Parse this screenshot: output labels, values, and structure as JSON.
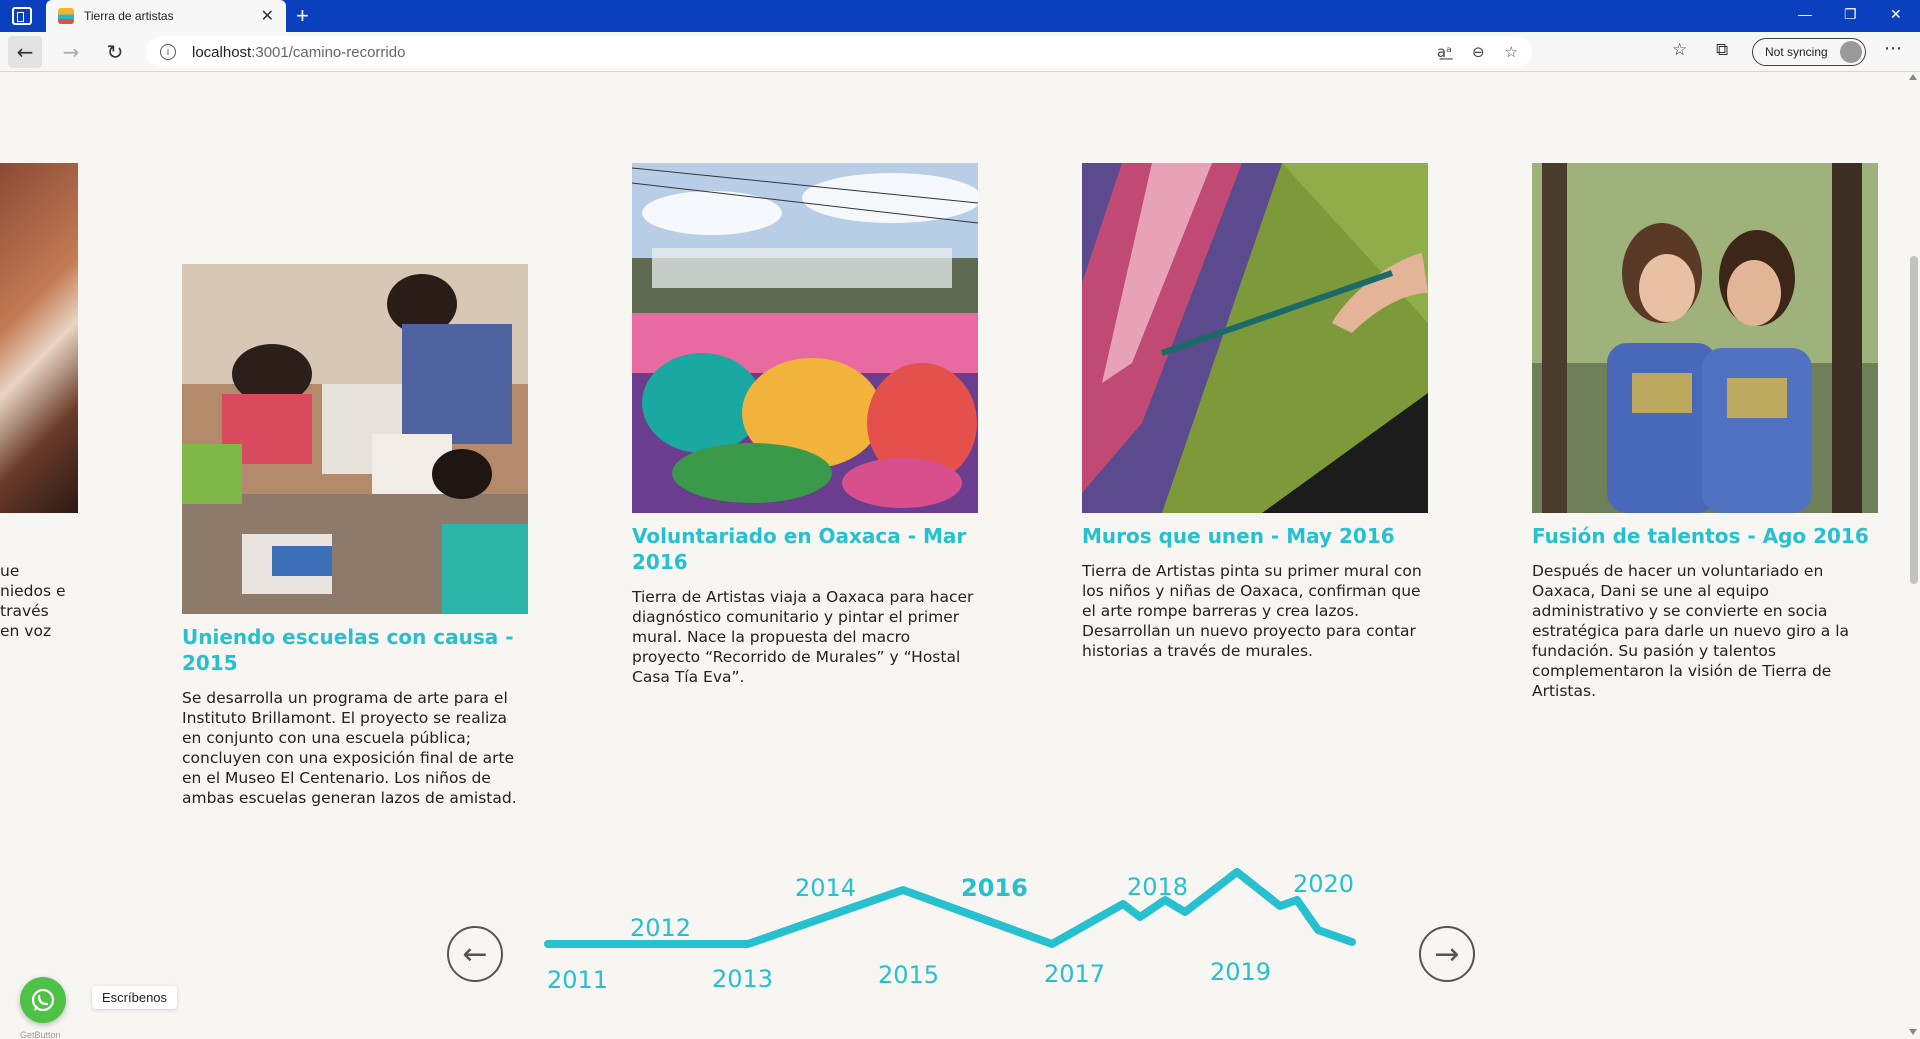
{
  "browser": {
    "tab_title": "Tierra de artistas",
    "tab_close": "✕",
    "new_tab": "+",
    "url_host": "localhost",
    "url_path": ":3001/camino-recorrido",
    "sync_label": "Not syncing",
    "minimize": "—",
    "maximize": "❐",
    "close": "✕"
  },
  "partial_card": {
    "lines": [
      "ue",
      "niedos e",
      "través",
      "en voz"
    ]
  },
  "cards": [
    {
      "title": "Uniendo escuelas con causa - 2015",
      "text": "Se desarrolla un programa de arte para el Instituto Brillamont. El proyecto se realiza en conjunto con una escuela pública; concluyen con una exposición final de arte en el Museo El Centenario. Los niños de ambas escuelas generan lazos de amistad."
    },
    {
      "title": "Voluntariado en Oaxaca - Mar 2016",
      "text": "Tierra de Artistas viaja a Oaxaca para hacer diagnóstico comunitario y pintar el primer mural. Nace la propuesta del macro proyecto “Recorrido de Murales” y “Hostal Casa Tía Eva”."
    },
    {
      "title": "Muros que unen - May 2016",
      "text": "Tierra de Artistas pinta su primer mural con los niños y niñas de Oaxaca, confirman que el arte rompe barreras y crea lazos. Desarrollan un nuevo proyecto para contar historias a través de murales."
    },
    {
      "title": "Fusión de talentos - Ago 2016",
      "text": "Después de hacer un voluntariado en Oaxaca, Dani se une al equipo administrativo y se convierte en socia estratégica para darle un nuevo giro a la fundación. Su pasión y talentos complementaron la visión de Tierra de Artistas."
    }
  ],
  "timeline": {
    "prev": "←",
    "next": "→",
    "years": [
      "2011",
      "2012",
      "2013",
      "2014",
      "2015",
      "2016",
      "2017",
      "2018",
      "2019",
      "2020"
    ],
    "active_year": "2016",
    "line_color": "#26c0cf"
  },
  "widget": {
    "label": "Escríbenos",
    "credit": "GetButton"
  },
  "colors": {
    "accent": "#26c0cf",
    "background": "#f7f6f2",
    "titlebar": "#0a3fbd",
    "whatsapp": "#4dc247"
  }
}
